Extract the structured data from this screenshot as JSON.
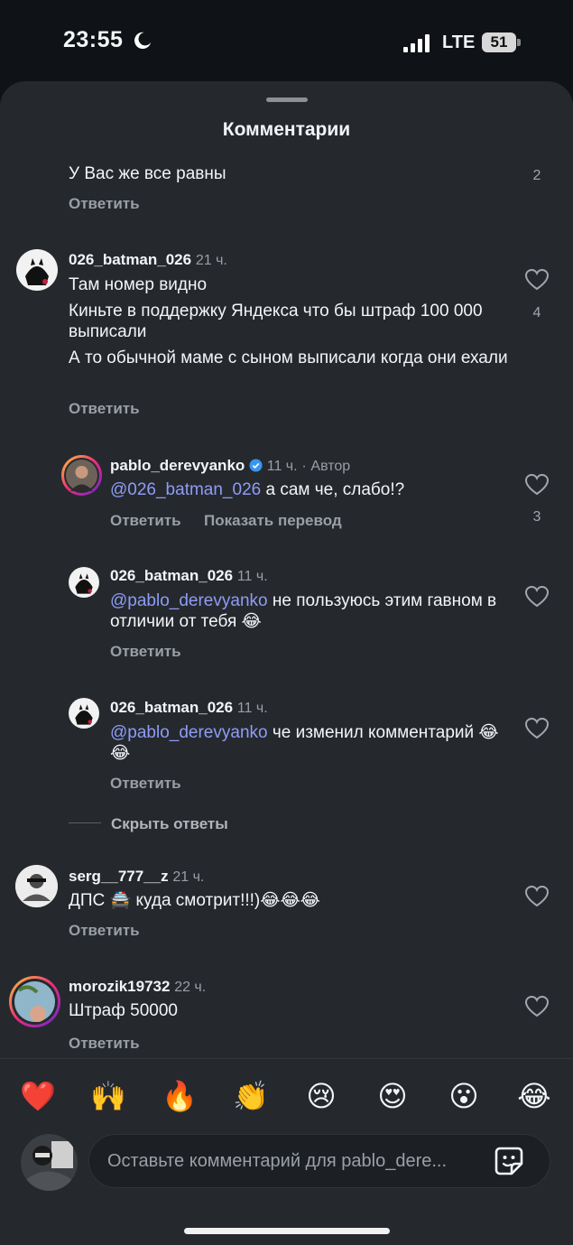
{
  "status_bar": {
    "time": "23:55",
    "network": "LTE",
    "battery": "51"
  },
  "sheet": {
    "title": "Комментарии"
  },
  "comments": [
    {
      "text": "У Вас же все равны",
      "reply_label": "Ответить",
      "likes": "2"
    },
    {
      "username": "026_batman_026",
      "time": "21 ч.",
      "lines": [
        "Там номер видно",
        "Киньте в поддержку Яндекса что бы штраф 100 000 выписали",
        "А то обычной маме с сыном выписали когда они ехали"
      ],
      "reply_label": "Ответить",
      "likes": "4"
    },
    {
      "username": "pablo_derevyanko",
      "time": "11 ч.",
      "separator": "·",
      "author_badge": "Автор",
      "mention": "@026_batman_026",
      "text": " а сам че, слабо!?",
      "reply_label": "Ответить",
      "translate_label": "Показать перевод",
      "likes": "3"
    },
    {
      "username": "026_batman_026",
      "time": "11 ч.",
      "mention": "@pablo_derevyanko",
      "text": " не пользуюсь этим гавном в отличии от тебя 😂",
      "reply_label": "Ответить"
    },
    {
      "username": "026_batman_026",
      "time": "11 ч.",
      "mention": "@pablo_derevyanko",
      "text": " че изменил комментарий 😂😂",
      "reply_label": "Ответить"
    },
    {
      "hide_replies_label": "Скрыть ответы"
    },
    {
      "username": "serg__777__z",
      "time": "21 ч.",
      "text": "ДПС 🚔 куда смотрит!!!)😂😂😂",
      "reply_label": "Ответить"
    },
    {
      "username": "morozik19732",
      "time": "22 ч.",
      "text": "Штраф 50000",
      "reply_label": "Ответить"
    }
  ],
  "reactions": [
    "❤️",
    "🙌",
    "🔥",
    "👏",
    "😢",
    "😍",
    "😮",
    "😂"
  ],
  "input": {
    "placeholder": "Оставьте комментарий для pablo_dere..."
  },
  "icons": {
    "moon": "moon-icon",
    "signal": "signal-icon",
    "heart": "heart-outline-icon",
    "verified": "verified-badge-icon",
    "sticker": "sticker-icon"
  },
  "colors": {
    "background": "#25292e",
    "mention": "#8f9cf5",
    "verified": "#3797f0",
    "muted": "#9a9fa5"
  }
}
